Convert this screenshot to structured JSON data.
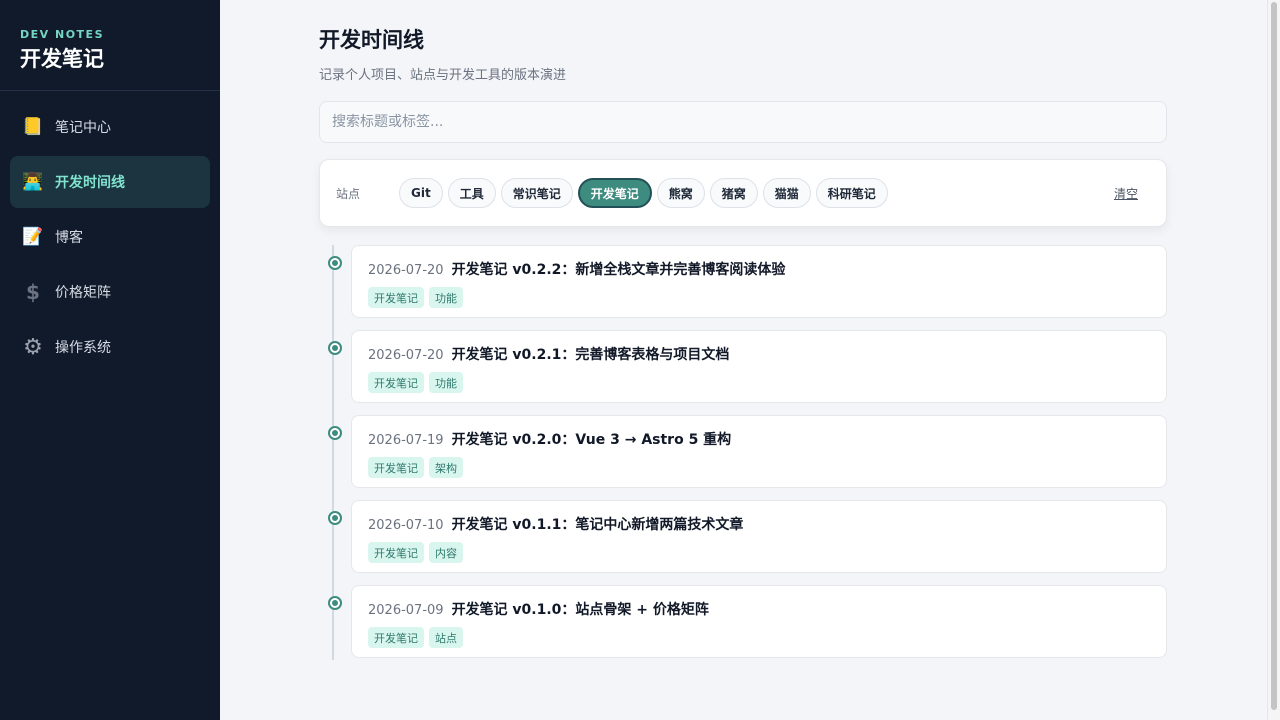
{
  "sidebar": {
    "brand_kicker": "DEV NOTES",
    "brand_title": "开发笔记",
    "items": [
      {
        "label": "笔记中心",
        "icon": "📒",
        "icon_name": "notebook-icon"
      },
      {
        "label": "开发时间线",
        "icon": "👨‍💻",
        "icon_name": "developer-icon",
        "active": true
      },
      {
        "label": "博客",
        "icon": "📝",
        "icon_name": "memo-icon"
      },
      {
        "label": "价格矩阵",
        "icon": "$",
        "icon_name": "dollar-icon"
      },
      {
        "label": "操作系统",
        "icon": "⚙",
        "icon_name": "gear-icon"
      }
    ]
  },
  "header": {
    "title": "开发时间线",
    "subtitle": "记录个人项目、站点与开发工具的版本演进"
  },
  "search": {
    "placeholder": "搜索标题或标签..."
  },
  "filters": {
    "label": "站点",
    "chips": [
      "Git",
      "工具",
      "常识笔记",
      "开发笔记",
      "熊窝",
      "猪窝",
      "猫猫",
      "科研笔记"
    ],
    "active": "开发笔记",
    "clear_label": "清空"
  },
  "timeline": [
    {
      "date": "2026-07-20",
      "title": "开发笔记 v0.2.2：新增全栈文章并完善博客阅读体验",
      "tags": [
        "开发笔记",
        "功能"
      ]
    },
    {
      "date": "2026-07-20",
      "title": "开发笔记 v0.2.1：完善博客表格与项目文档",
      "tags": [
        "开发笔记",
        "功能"
      ]
    },
    {
      "date": "2026-07-19",
      "title": "开发笔记 v0.2.0：Vue 3 → Astro 5 重构",
      "tags": [
        "开发笔记",
        "架构"
      ]
    },
    {
      "date": "2026-07-10",
      "title": "开发笔记 v0.1.1：笔记中心新增两篇技术文章",
      "tags": [
        "开发笔记",
        "内容"
      ]
    },
    {
      "date": "2026-07-09",
      "title": "开发笔记 v0.1.0：站点骨架 + 价格矩阵",
      "tags": [
        "开发笔记",
        "站点"
      ]
    }
  ],
  "colors": {
    "sidebar_bg": "#111a2b",
    "accent": "#3e8b80",
    "accent_text": "#7fe3cf",
    "tag_bg": "#d8f5ee"
  }
}
